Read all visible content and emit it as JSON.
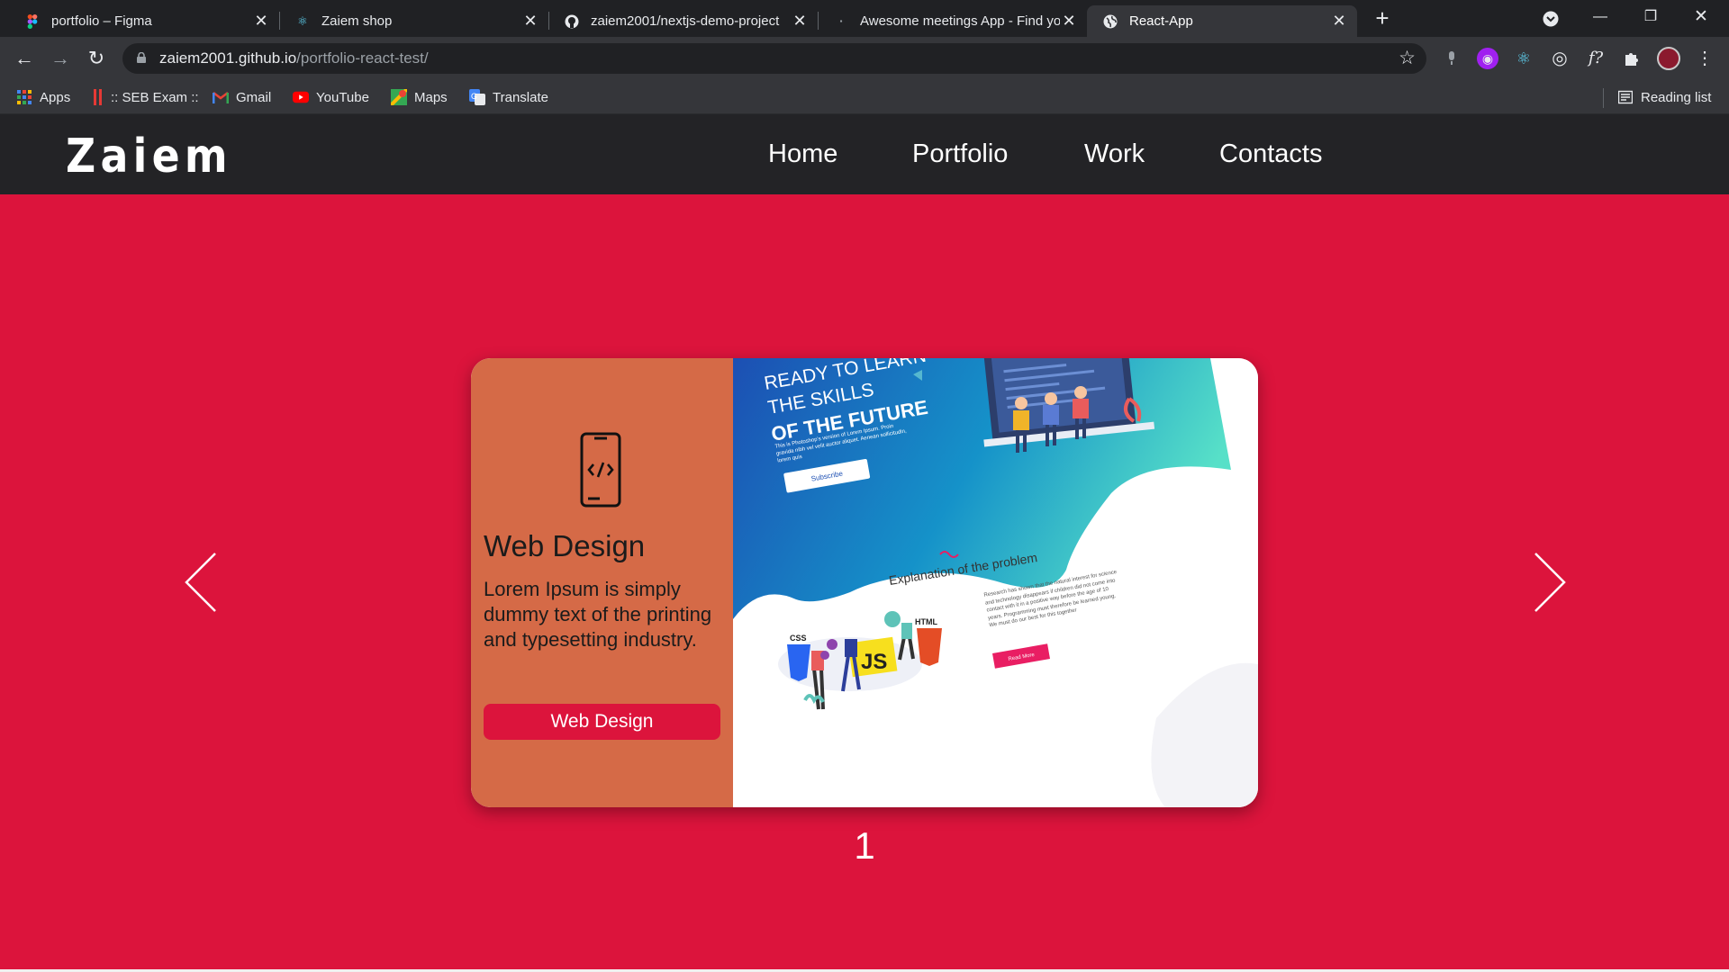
{
  "browser": {
    "tabs": [
      {
        "title": "portfolio – Figma",
        "icon": "figma-icon"
      },
      {
        "title": "Zaiem shop",
        "icon": "react-icon"
      },
      {
        "title": "zaiem2001/nextjs-demo-project",
        "icon": "github-icon"
      },
      {
        "title": "Awesome meetings App - Find your",
        "icon": "loading-icon"
      },
      {
        "title": "React-App",
        "icon": "globe-icon"
      }
    ],
    "active_tab": 4,
    "url_host": "zaiem2001.github.io",
    "url_path": "/portfolio-react-test/",
    "bookmarks": [
      {
        "label": "Apps",
        "icon": "apps-grid-icon"
      },
      {
        "label": ":: SEB Exam ::",
        "icon": "seb-icon"
      },
      {
        "label": "Gmail",
        "icon": "gmail-icon"
      },
      {
        "label": "YouTube",
        "icon": "youtube-icon"
      },
      {
        "label": "Maps",
        "icon": "maps-icon"
      },
      {
        "label": "Translate",
        "icon": "translate-icon"
      }
    ],
    "reading_list": "Reading list"
  },
  "site": {
    "logo": "Zaiem",
    "nav": [
      "Home",
      "Portfolio",
      "Work",
      "Contacts"
    ],
    "colors": {
      "accent": "#dc143c",
      "header": "#232326",
      "card_left": "#d56a47"
    }
  },
  "slide": {
    "icon": "mobile-code-icon",
    "title": "Web Design",
    "description": "Lorem Ipsum is simply dummy text of the printing and typesetting industry.",
    "button": "Web Design",
    "counter": "1",
    "image": {
      "headline_line1": "READY TO LEARN",
      "headline_line2": "THE SKILLS",
      "headline_line3": "OF THE FUTURE",
      "blurb": "This is Photoshop's version of Lorem Ipsum. Proin gravida nibh vel velit auctor aliquet. Aenean sollicitudin, lorem quis",
      "subscribe": "Subscribe",
      "section_title": "Explanation of the problem",
      "section_text": "Research has shown that the natural interest for science and technology disappears if children did not come into contact with it in a positive way before the age of 10 years. Programming must therefore be learned young. We must do our best for this together",
      "read_more": "Read More",
      "badges": [
        "CSS",
        "JS",
        "HTML"
      ]
    }
  }
}
